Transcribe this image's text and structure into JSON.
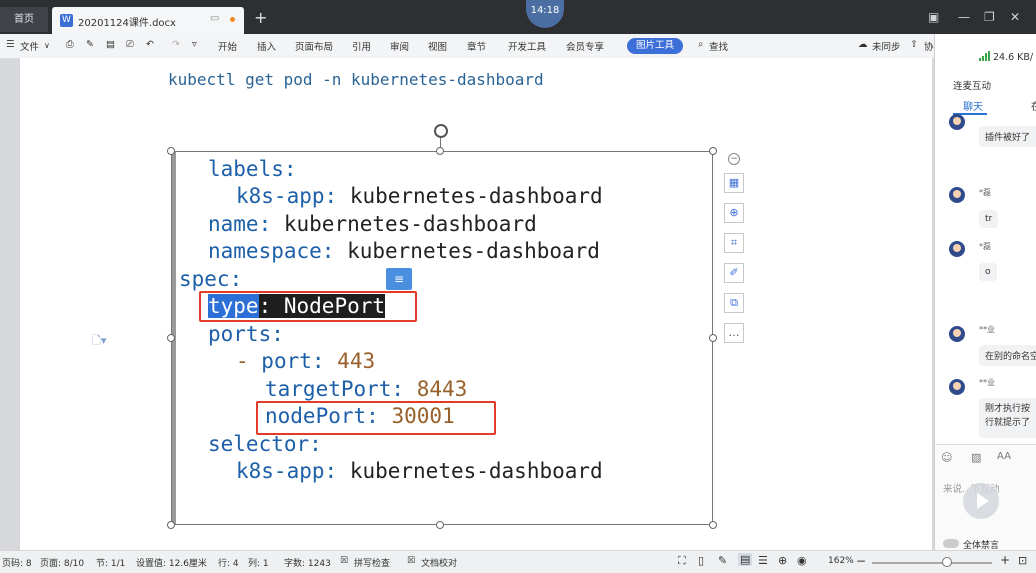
{
  "titlebar": {
    "home_tab": "首页",
    "doc_tab": "20201124课件.docx",
    "add_tab": "+",
    "clock": "14:18"
  },
  "toolbar": {
    "file": "文件",
    "menus": [
      "开始",
      "插入",
      "页面布局",
      "引用",
      "审阅",
      "视图",
      "章节",
      "开发工具",
      "会员专享"
    ],
    "image_tools": "图片工具",
    "search": "查找",
    "sync": "未同步",
    "collab": "协"
  },
  "document": {
    "command": "kubectl get pod -n kubernetes-dashboard",
    "code": {
      "labels_key": "labels:",
      "k8s_app_key": "k8s-app:",
      "k8s_app_val": "kubernetes-dashboard",
      "name_key": "name:",
      "name_val": "kubernetes-dashboard",
      "namespace_key": "namespace:",
      "namespace_val": "kubernetes-dashboard",
      "spec_key": "spec:",
      "type_key": "type",
      "type_colon": ":",
      "type_val": " NodePort",
      "ports_key": "ports:",
      "dash": "- ",
      "port_key": "port:",
      "port_val": "443",
      "target_key": "targetPort:",
      "target_val": "8443",
      "node_key": "nodePort:",
      "node_val": "30001",
      "selector_key": "selector:",
      "sel_app_key": "k8s-app:",
      "sel_app_val": "kubernetes-dashboard"
    }
  },
  "chat": {
    "network": "24.6 KB/",
    "link": "连麦互动",
    "tab_chat": "聊天",
    "tab_other": "在",
    "messages": [
      {
        "user": "",
        "text": "插件被好了"
      },
      {
        "user": "*磊",
        "text": "tr"
      },
      {
        "user": "*磊",
        "text": "o"
      },
      {
        "user": "**业",
        "text": "在别的命名空"
      },
      {
        "user": "**业",
        "text": "刚才执行按\n行就提示了"
      }
    ],
    "input_placeholder": "来说...下互动",
    "mute_all": "全体禁言"
  },
  "status": {
    "page_no": "页码: 8",
    "pages": "页面: 8/10",
    "section": "节: 1/1",
    "setting": "设置值: 12.6厘米",
    "row": "行: 4",
    "col": "列: 1",
    "words": "字数: 1243",
    "spell": "拼写检查",
    "proof": "文档校对",
    "zoom": "162%"
  },
  "colors": {
    "accent": "#3d6fd8",
    "highlight_box": "#e23b2a"
  }
}
